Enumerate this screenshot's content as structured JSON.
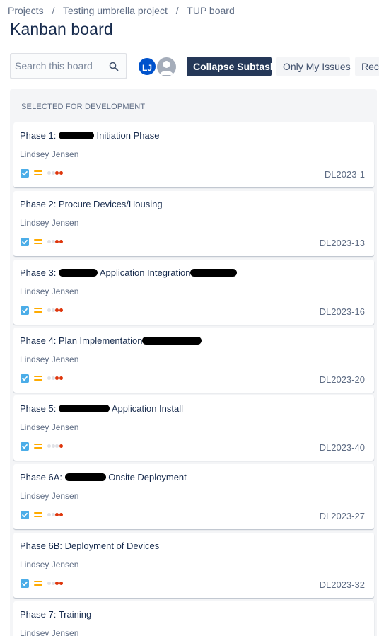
{
  "breadcrumb": {
    "items": [
      "Projects",
      "Testing umbrella project",
      "TUP board"
    ],
    "separator": "/"
  },
  "page": {
    "title": "Kanban board"
  },
  "toolbar": {
    "search_placeholder": "Search this board",
    "avatar_initials": "LJ",
    "collapse_label": "Collapse Subtasks",
    "only_my_label": "Only My Issues",
    "recent_label": "Rece"
  },
  "column": {
    "title": "Selected for Development"
  },
  "colors": {
    "accent": "#0052cc",
    "dark_button": "#253858",
    "story_blue": "#4bade8",
    "priority_medium": "#ffab00",
    "dot_red": "#de350b",
    "dot_grey": "#dfe1e6"
  },
  "cards": [
    {
      "title_before": "Phase 1: ",
      "title_after": " Initiation Phase",
      "assignee": "Lindsey Jensen",
      "key": "DL2023-1",
      "dots": [
        "grey",
        "grey",
        "red",
        "red"
      ]
    },
    {
      "title_before": "Phase 2: Procure Devices/Housing",
      "title_after": "",
      "assignee": "Lindsey Jensen",
      "key": "DL2023-13",
      "dots": [
        "grey",
        "grey",
        "red",
        "red"
      ]
    },
    {
      "title_before": "Phase 3: ",
      "title_after": " Application Integration",
      "assignee": "Lindsey Jensen",
      "key": "DL2023-16",
      "dots": [
        "grey",
        "grey",
        "red",
        "red"
      ]
    },
    {
      "title_before": "Phase 4: Plan Implementation",
      "title_after": "",
      "assignee": "Lindsey Jensen",
      "key": "DL2023-20",
      "dots": [
        "grey",
        "grey",
        "red",
        "red"
      ]
    },
    {
      "title_before": "Phase 5: ",
      "title_after": " Application Install",
      "assignee": "Lindsey Jensen",
      "key": "DL2023-40",
      "dots": [
        "grey",
        "grey",
        "grey",
        "red"
      ]
    },
    {
      "title_before": "Phase 6A: ",
      "title_after": " Onsite Deployment",
      "assignee": "Lindsey Jensen",
      "key": "DL2023-27",
      "dots": [
        "grey",
        "grey",
        "red",
        "red"
      ]
    },
    {
      "title_before": "Phase 6B: Deployment of Devices",
      "title_after": "",
      "assignee": "Lindsey Jensen",
      "key": "DL2023-32",
      "dots": [
        "grey",
        "grey",
        "red",
        "red"
      ]
    },
    {
      "title_before": "Phase 7: Training",
      "title_after": "",
      "assignee": "Lindsey Jensen",
      "key": "",
      "dots": []
    }
  ]
}
